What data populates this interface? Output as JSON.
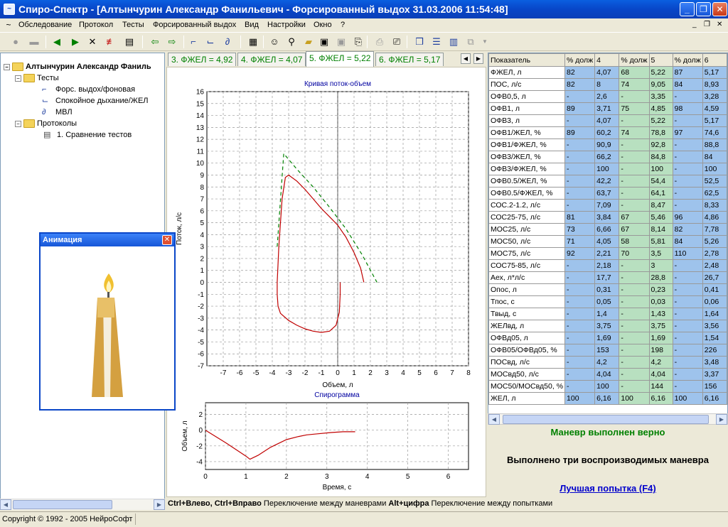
{
  "window": {
    "title": "Спиро-Спектр - [Алтынчурин Александр Фанильевич - Форсированный выдох 31.03.2006 11:54:48]"
  },
  "menu": [
    "Обследование",
    "Протокол",
    "Тесты",
    "Форсированный выдох",
    "Вид",
    "Настройки",
    "Окно",
    "?"
  ],
  "tree": {
    "patient": "Алтынчурин Александр Фаниль",
    "tests": "Тесты",
    "test_items": [
      "Форс. выдох/фоновая",
      "Спокойное дыхание/ЖЕЛ",
      "МВЛ"
    ],
    "protocols": "Протоколы",
    "protocol_items": [
      "1. Сравнение тестов"
    ]
  },
  "tabs": [
    {
      "label": "3. ФЖЕЛ = 4,92"
    },
    {
      "label": "4. ФЖЕЛ = 4,07"
    },
    {
      "label": "5. ФЖЕЛ = 5,22"
    },
    {
      "label": "6. ФЖЕЛ = 5,17"
    }
  ],
  "flow_chart": {
    "title": "Кривая поток-объем",
    "xlabel": "Объем, л",
    "ylabel": "Поток, л/с",
    "x_ticks": [
      "-7",
      "-6",
      "-5",
      "-4",
      "-3",
      "-2",
      "-1",
      "0",
      "1",
      "2",
      "3",
      "4",
      "5",
      "6",
      "7",
      "8"
    ],
    "y_ticks": [
      "16",
      "15",
      "14",
      "13",
      "12",
      "11",
      "10",
      "9",
      "8",
      "7",
      "6",
      "5",
      "4",
      "3",
      "2",
      "1",
      "0",
      "-1",
      "-2",
      "-3",
      "-4",
      "-5",
      "-6",
      "-7"
    ]
  },
  "spiro_chart": {
    "title": "Спирограмма",
    "xlabel": "Время, с",
    "ylabel": "Объем, л",
    "x_ticks": [
      "0",
      "1",
      "2",
      "3",
      "4",
      "5",
      "6"
    ],
    "y_ticks": [
      "-4",
      "-2",
      "0",
      "2"
    ]
  },
  "chart_data": [
    {
      "type": "line",
      "title": "Кривая поток-объем",
      "xlabel": "Объем, л",
      "ylabel": "Поток, л/с",
      "xlim": [
        -8,
        8
      ],
      "ylim": [
        -7,
        16
      ],
      "grid": true,
      "series": [
        {
          "color": "#c00000",
          "style": "solid",
          "points": [
            [
              -3.7,
              0
            ],
            [
              -3.7,
              -1
            ],
            [
              -3.65,
              -2
            ],
            [
              -3.5,
              -2.6
            ],
            [
              -3,
              -3.2
            ],
            [
              -2.5,
              -3.6
            ],
            [
              -2,
              -3.9
            ],
            [
              -1.5,
              -4.1
            ],
            [
              -1,
              -4.2
            ],
            [
              -0.5,
              -4.1
            ],
            [
              -0.1,
              -3.6
            ],
            [
              0.1,
              -2.5
            ],
            [
              0.15,
              -1
            ],
            [
              0.15,
              0
            ]
          ]
        },
        {
          "color": "#c00000",
          "style": "solid",
          "points": [
            [
              -3.7,
              0
            ],
            [
              -3.6,
              3
            ],
            [
              -3.4,
              7
            ],
            [
              -3.2,
              8.8
            ],
            [
              -3,
              9
            ],
            [
              -2.5,
              8.5
            ],
            [
              -2,
              7.8
            ],
            [
              -1.5,
              7
            ],
            [
              -1,
              6.2
            ],
            [
              -0.5,
              5.5
            ],
            [
              0,
              4.8
            ],
            [
              0.5,
              3.8
            ],
            [
              1,
              2.5
            ],
            [
              1.4,
              1.2
            ],
            [
              1.6,
              0
            ]
          ]
        },
        {
          "color": "#008000",
          "style": "dashed",
          "points": [
            [
              -3.7,
              3
            ],
            [
              -3.3,
              10.8
            ],
            [
              -2.5,
              9.5
            ],
            [
              -1.5,
              8
            ],
            [
              -0.5,
              6.3
            ],
            [
              0.5,
              4.5
            ],
            [
              1.5,
              2.3
            ],
            [
              2.4,
              0
            ]
          ]
        }
      ]
    },
    {
      "type": "line",
      "title": "Спирограмма",
      "xlabel": "Время, с",
      "ylabel": "Объем, л",
      "xlim": [
        0,
        6.5
      ],
      "ylim": [
        -5,
        3.5
      ],
      "grid": true,
      "series": [
        {
          "color": "#c00000",
          "style": "solid",
          "points": [
            [
              0,
              0
            ],
            [
              0.5,
              -1.6
            ],
            [
              1,
              -3.3
            ],
            [
              1.1,
              -3.7
            ],
            [
              1.3,
              -3.2
            ],
            [
              1.6,
              -2.2
            ],
            [
              2,
              -1.2
            ],
            [
              2.3,
              -0.8
            ],
            [
              2.5,
              -0.6
            ],
            [
              2.7,
              -0.5
            ],
            [
              3.1,
              -0.3
            ],
            [
              3.4,
              -0.2
            ],
            [
              3.7,
              -0.2
            ]
          ]
        }
      ]
    }
  ],
  "grid": {
    "headers": [
      "Показатель",
      "% долж",
      "4",
      "% долж",
      "5",
      "% долж",
      "6"
    ],
    "rows": [
      [
        "ФЖЕЛ, л",
        "82",
        "4,07",
        "68",
        "5,22",
        "87",
        "5,17"
      ],
      [
        "ПОС, л/с",
        "82",
        "8",
        "74",
        "9,05",
        "84",
        "8,93"
      ],
      [
        "ОФВ0,5, л",
        "-",
        "2,6",
        "-",
        "3,35",
        "-",
        "3,28"
      ],
      [
        "ОФВ1, л",
        "89",
        "3,71",
        "75",
        "4,85",
        "98",
        "4,59"
      ],
      [
        "ОФВ3, л",
        "-",
        "4,07",
        "-",
        "5,22",
        "-",
        "5,17"
      ],
      [
        "ОФВ1/ЖЕЛ, %",
        "89",
        "60,2",
        "74",
        "78,8",
        "97",
        "74,6"
      ],
      [
        "ОФВ1/ФЖЕЛ, %",
        "-",
        "90,9",
        "-",
        "92,8",
        "-",
        "88,8"
      ],
      [
        "ОФВ3/ЖЕЛ, %",
        "-",
        "66,2",
        "-",
        "84,8",
        "-",
        "84"
      ],
      [
        "ОФВ3/ФЖЕЛ, %",
        "-",
        "100",
        "-",
        "100",
        "-",
        "100"
      ],
      [
        "ОФВ0.5/ЖЕЛ, %",
        "-",
        "42,2",
        "-",
        "54,4",
        "-",
        "52,5"
      ],
      [
        "ОФВ0.5/ФЖЕЛ, %",
        "-",
        "63,7",
        "-",
        "64,1",
        "-",
        "62,5"
      ],
      [
        "СОС.2-1.2, л/с",
        "-",
        "7,09",
        "-",
        "8,47",
        "-",
        "8,33"
      ],
      [
        "СОС25-75, л/с",
        "81",
        "3,84",
        "67",
        "5,46",
        "96",
        "4,86"
      ],
      [
        "МОС25, л/с",
        "73",
        "6,66",
        "67",
        "8,14",
        "82",
        "7,78"
      ],
      [
        "МОС50, л/с",
        "71",
        "4,05",
        "58",
        "5,81",
        "84",
        "5,26"
      ],
      [
        "МОС75, л/с",
        "92",
        "2,21",
        "70",
        "3,5",
        "110",
        "2,78"
      ],
      [
        "СОС75-85, л/с",
        "-",
        "2,18",
        "-",
        "3",
        "-",
        "2,48"
      ],
      [
        "Аех, л*л/с",
        "-",
        "17,7",
        "-",
        "28,8",
        "-",
        "26,7"
      ],
      [
        "Опос, л",
        "-",
        "0,31",
        "-",
        "0,23",
        "-",
        "0,41"
      ],
      [
        "Тпос, с",
        "-",
        "0,05",
        "-",
        "0,03",
        "-",
        "0,06"
      ],
      [
        "Твыд, с",
        "-",
        "1,4",
        "-",
        "1,43",
        "-",
        "1,64"
      ],
      [
        "ЖЕЛвд, л",
        "-",
        "3,75",
        "-",
        "3,75",
        "-",
        "3,56"
      ],
      [
        "ОФВд05, л",
        "-",
        "1,69",
        "-",
        "1,69",
        "-",
        "1,54"
      ],
      [
        "ОФВ05/ОФВд05, %",
        "-",
        "153",
        "-",
        "198",
        "-",
        "226"
      ],
      [
        "ПОСвд, л/с",
        "-",
        "4,2",
        "-",
        "4,2",
        "-",
        "3,48"
      ],
      [
        "МОСвд50, л/с",
        "-",
        "4,04",
        "-",
        "4,04",
        "-",
        "3,37"
      ],
      [
        "МОС50/МОСвд50, %",
        "-",
        "100",
        "-",
        "144",
        "-",
        "156"
      ],
      [
        "ЖЕЛ, л",
        "100",
        "6,16",
        "100",
        "6,16",
        "100",
        "6,16"
      ]
    ]
  },
  "messages": {
    "maneuver_ok": "Маневр выполнен верно",
    "three_reproducible": "Выполнено три воспроизводимых маневра",
    "best_attempt_link": "Лучшая попытка (F4)"
  },
  "hint_bar": {
    "key1": "Ctrl+Влево, Ctrl+Вправо",
    "text1": "Переключение между маневрами",
    "key2": "Alt+цифра",
    "text2": "Переключение между попытками"
  },
  "status": {
    "copyright": "Copyright © 1992 - 2005 НейроСофт"
  },
  "animation": {
    "title": "Анимация"
  },
  "colors": {
    "accent_blue": "#0a46c8",
    "series_red": "#c00000",
    "series_green": "#008000",
    "msg_green": "#008000",
    "link_blue": "#0000cc"
  }
}
